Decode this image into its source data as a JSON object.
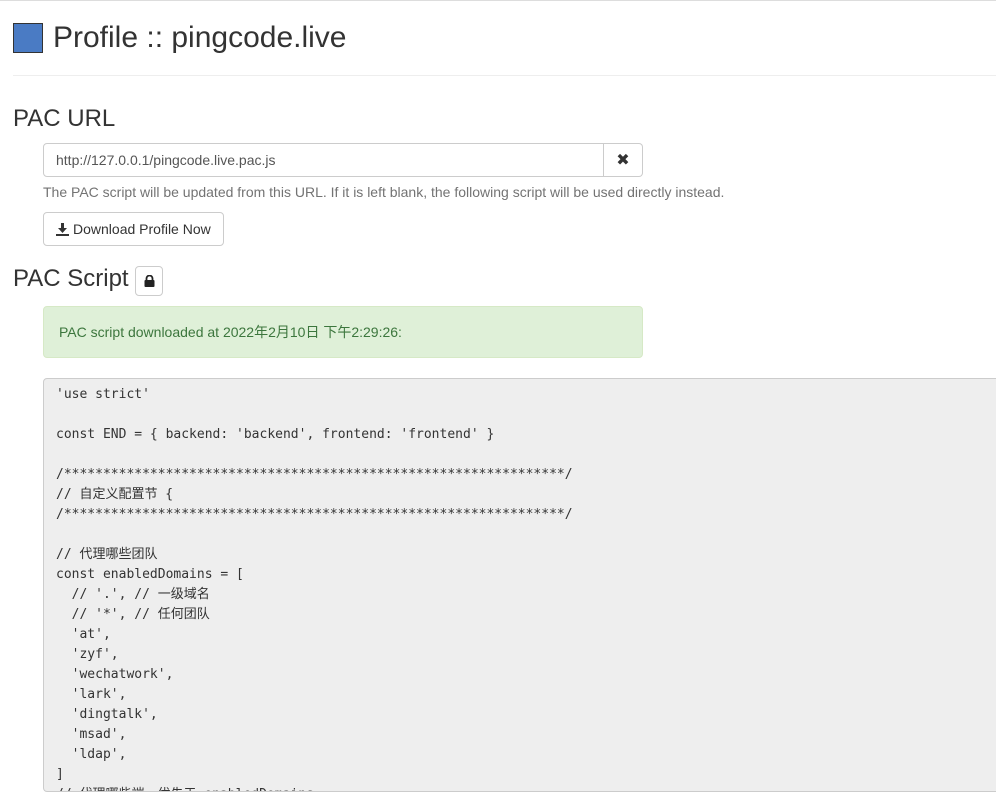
{
  "header": {
    "title": "Profile :: pingcode.live",
    "profile_color": "#4a7bc4"
  },
  "pac_url": {
    "heading": "PAC URL",
    "value": "http://127.0.0.1/pingcode.live.pac.js",
    "clear_icon": "times-icon",
    "help": "The PAC script will be updated from this URL. If it is left blank, the following script will be used directly instead.",
    "download_label": "Download Profile Now"
  },
  "pac_script": {
    "heading": "PAC Script",
    "lock_icon": "lock-icon",
    "alert": "PAC script downloaded at 2022年2月10日 下午2:29:26:",
    "lines": [
      "'use strict'",
      "",
      "const END = { backend: 'backend', frontend: 'frontend' }",
      "",
      "/****************************************************************/",
      "// 自定义配置节 {",
      "/****************************************************************/",
      "",
      "// 代理哪些团队",
      "const enabledDomains = [",
      "  // '.', // 一级域名",
      "  // '*', // 任何团队",
      "  'at',",
      "  'zyf',",
      "  'wechatwork',",
      "  'lark',",
      "  'dingtalk',",
      "  'msad',",
      "  'ldap',",
      "]",
      "// 代理哪些端，优先于 enabledDomains"
    ]
  }
}
